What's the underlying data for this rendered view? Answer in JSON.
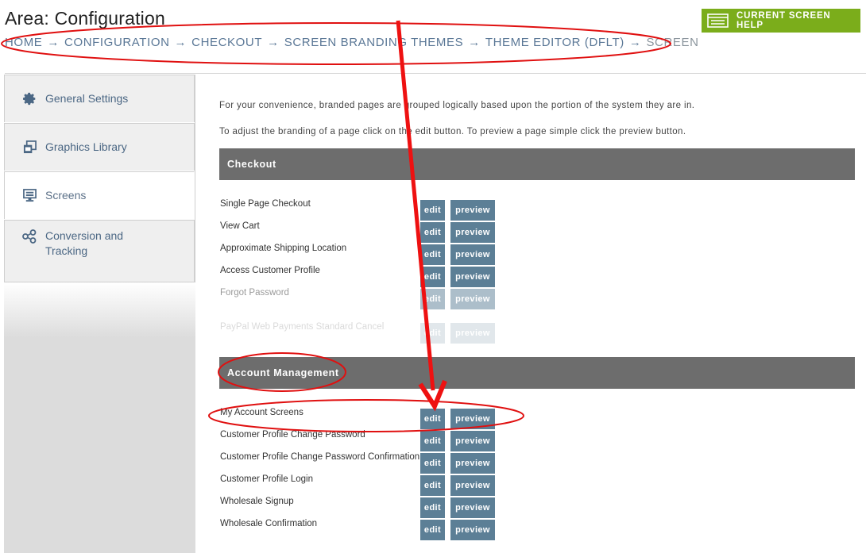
{
  "header": {
    "title": "Area: Configuration",
    "help_label": "CURRENT SCREEN HELP",
    "breadcrumb": [
      "HOME",
      "CONFIGURATION",
      "CHECKOUT",
      "SCREEN BRANDING THEMES",
      "THEME EDITOR (DFLT)",
      "SCREEN"
    ],
    "breadcrumb_separator": "→"
  },
  "sidebar": {
    "items": [
      {
        "label": "General Settings",
        "icon": "gear-icon"
      },
      {
        "label": "Graphics Library",
        "icon": "images-icon"
      },
      {
        "label": "Screens",
        "icon": "monitor-icon",
        "active": true
      },
      {
        "label": "Conversion and Tracking",
        "icon": "share-nodes-icon"
      }
    ]
  },
  "content": {
    "intro1": "For your convenience, branded pages are grouped logically based upon the portion of the system they are in.",
    "intro2": "To adjust the branding of a page click on the edit button. To preview a page simple click the preview button.",
    "edit_label": "edit",
    "preview_label": "preview",
    "sections": [
      {
        "title": "Checkout",
        "rows": [
          "Single Page Checkout",
          "View Cart",
          "Approximate Shipping Location",
          "Access Customer Profile",
          "Forgot Password",
          "PayPal Web Payments Standard Cancel"
        ]
      },
      {
        "title": "Account Management",
        "rows": [
          "My Account Screens",
          "Customer Profile Change Password",
          "Customer Profile Change Password Confirmation",
          "Customer Profile Login",
          "Wholesale Signup",
          "Wholesale Confirmation"
        ]
      }
    ]
  },
  "colors": {
    "help_button": "#7bad1b",
    "section_header": "#6d6d6d",
    "action_button": "#5c7f96",
    "annotation": "#e00000"
  }
}
